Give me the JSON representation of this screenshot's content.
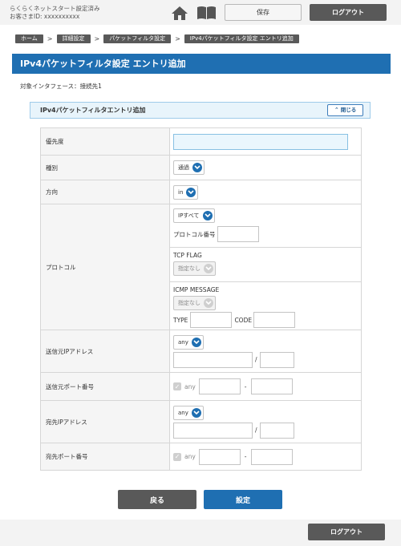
{
  "header": {
    "status_line1": "らくらくネットスタート設定済み",
    "status_line2": "お客さまID: xxxxxxxxxx",
    "save_label": "保存",
    "logout_label": "ログアウト"
  },
  "breadcrumb": [
    "ホーム",
    "詳細設定",
    "パケットフィルタ設定",
    "IPv4パケットフィルタ設定 エントリ追加"
  ],
  "page_title": "IPv4パケットフィルタ設定 エントリ追加",
  "interface_label": "対象インタフェース：接続先1",
  "panel": {
    "title": "IPv4パケットフィルタエントリ追加",
    "close_label": "閉じる"
  },
  "form": {
    "priority": {
      "label": "優先度",
      "value": ""
    },
    "type": {
      "label": "種別",
      "selected": "通過"
    },
    "direction": {
      "label": "方向",
      "selected": "in"
    },
    "protocol": {
      "label": "プロトコル",
      "selected": "IPすべて",
      "number_label": "プロトコル番号",
      "tcp_flag_label": "TCP FLAG",
      "tcp_flag_selected": "指定なし",
      "icmp_label": "ICMP MESSAGE",
      "icmp_selected": "指定なし",
      "type_label": "TYPE",
      "code_label": "CODE"
    },
    "src_ip": {
      "label": "送信元IPアドレス",
      "selected": "any",
      "slash": "/"
    },
    "src_port": {
      "label": "送信元ポート番号",
      "any_label": "any",
      "dash": "-"
    },
    "dst_ip": {
      "label": "宛先IPアドレス",
      "selected": "any",
      "slash": "/"
    },
    "dst_port": {
      "label": "宛先ポート番号",
      "any_label": "any",
      "dash": "-"
    }
  },
  "buttons": {
    "back": "戻る",
    "set": "設定"
  },
  "footer": {
    "logout_label": "ログアウト"
  },
  "colors": {
    "accent": "#1f6fb2",
    "dark": "#595959"
  }
}
